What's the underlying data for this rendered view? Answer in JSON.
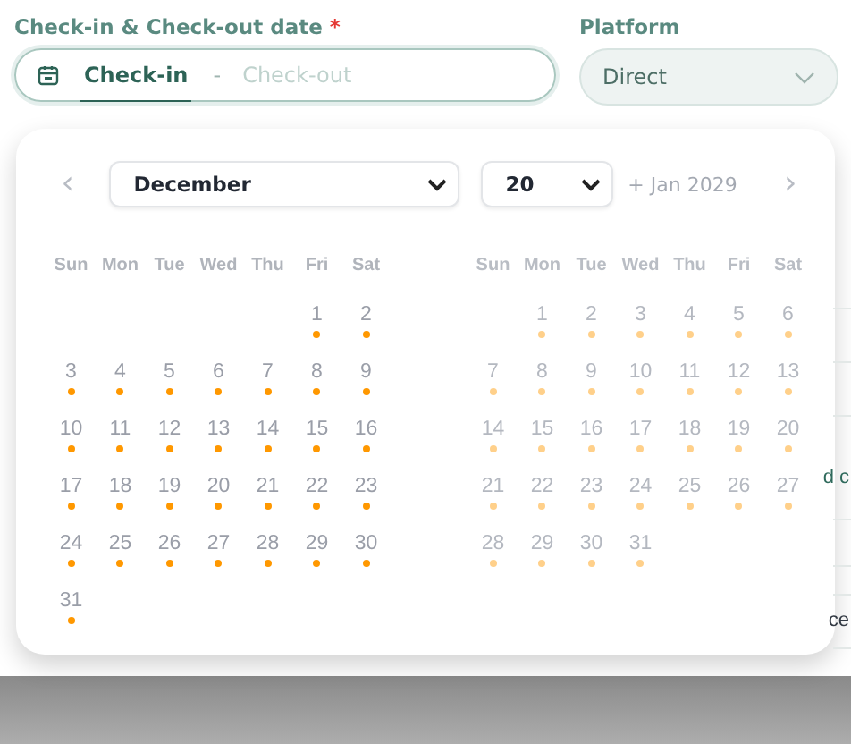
{
  "date_field": {
    "label": "Check-in & Check-out date",
    "required_mark": "*",
    "start": {
      "text": "Check-in",
      "active": true
    },
    "separator": "-",
    "end": {
      "placeholder": "Check-out"
    }
  },
  "platform": {
    "label": "Platform",
    "value": "Direct"
  },
  "background_fragments": [
    "d c",
    "ce"
  ],
  "calendar": {
    "prev": "‹",
    "next": "›",
    "month_select": "December",
    "year_select": "20",
    "next_hint": "+ Jan 2029",
    "months": [
      {
        "dimmed": false,
        "days_marked": true,
        "weekdays": [
          "Sun",
          "Mon",
          "Tue",
          "Wed",
          "Thu",
          "Fri",
          "Sat"
        ],
        "weeks": [
          [
            "1",
            "2"
          ],
          [
            "3",
            "4",
            "5",
            "6",
            "7",
            "8",
            "9"
          ],
          [
            "10",
            "11",
            "12",
            "13",
            "14",
            "15",
            "16"
          ],
          [
            "17",
            "18",
            "19",
            "20",
            "21",
            "22",
            "23"
          ],
          [
            "24",
            "25",
            "26",
            "27",
            "28",
            "29",
            "30"
          ],
          [
            "31"
          ]
        ]
      },
      {
        "dimmed": true,
        "days_marked": true,
        "weekdays": [
          "Sun",
          "Mon",
          "Tue",
          "Wed",
          "Thu",
          "Fri",
          "Sat"
        ],
        "weeks": [
          [
            "1",
            "2",
            "3",
            "4",
            "5",
            "6"
          ],
          [
            "7",
            "8",
            "9",
            "10",
            "11",
            "12",
            "13"
          ],
          [
            "14",
            "15",
            "16",
            "17",
            "18",
            "19",
            "20"
          ],
          [
            "21",
            "22",
            "23",
            "24",
            "25",
            "26",
            "27"
          ],
          [
            "28",
            "29",
            "30",
            "31"
          ]
        ]
      }
    ]
  }
}
